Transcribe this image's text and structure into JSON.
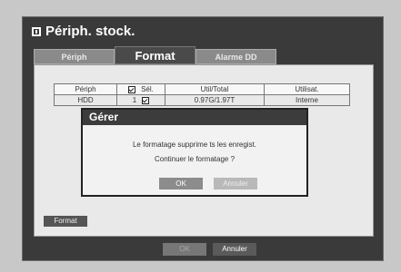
{
  "window": {
    "title": "Périph. stock."
  },
  "tabs": [
    {
      "label": "Périph"
    },
    {
      "label": "Format"
    },
    {
      "label": "Alarme DD"
    }
  ],
  "table": {
    "headers": [
      "Périph",
      "Sél.",
      "Util/Total",
      "Utilisat."
    ],
    "rows": [
      {
        "device": "HDD",
        "sel": "1",
        "usage": "0.97G/1.97T",
        "type": "Interne"
      }
    ]
  },
  "format_button": "Format",
  "dialog": {
    "title": "Gérer",
    "line1": "Le formatage supprime ts les enregist.",
    "line2": "Continuer le formatage ?",
    "ok": "OK",
    "cancel": "Annuler"
  },
  "footer": {
    "ok": "OK",
    "cancel": "Annuler"
  }
}
